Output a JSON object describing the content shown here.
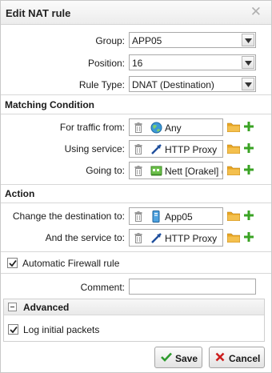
{
  "dialog": {
    "title": "Edit NAT rule"
  },
  "fields": {
    "group": {
      "label": "Group:",
      "value": "APP05"
    },
    "position": {
      "label": "Position:",
      "value": "16"
    },
    "rule_type": {
      "label": "Rule Type:",
      "value": "DNAT (Destination)"
    }
  },
  "matching": {
    "heading": "Matching Condition",
    "traffic_from": {
      "label": "For traffic from:",
      "value": "Any",
      "icon": "globe-icon"
    },
    "using_service": {
      "label": "Using service:",
      "value": "HTTP Proxy",
      "icon": "service-arrow-icon"
    },
    "going_to": {
      "label": "Going to:",
      "value": "Nett [Orakel] (",
      "icon": "network-icon"
    }
  },
  "action": {
    "heading": "Action",
    "change_destination": {
      "label": "Change the destination to:",
      "value": "App05",
      "icon": "host-icon"
    },
    "and_service": {
      "label": "And the service to:",
      "value": "HTTP Proxy",
      "icon": "service-arrow-icon"
    }
  },
  "auto_firewall": {
    "label": "Automatic Firewall rule",
    "checked": true
  },
  "comment": {
    "label": "Comment:",
    "value": ""
  },
  "advanced": {
    "title": "Advanced",
    "log_initial": {
      "label": "Log initial packets",
      "checked": true
    }
  },
  "buttons": {
    "save": "Save",
    "cancel": "Cancel"
  },
  "colors": {
    "folder": "#e8a623",
    "plus": "#3aa324",
    "save_check": "#2e9b2e",
    "cancel_x": "#cc1f1f"
  }
}
